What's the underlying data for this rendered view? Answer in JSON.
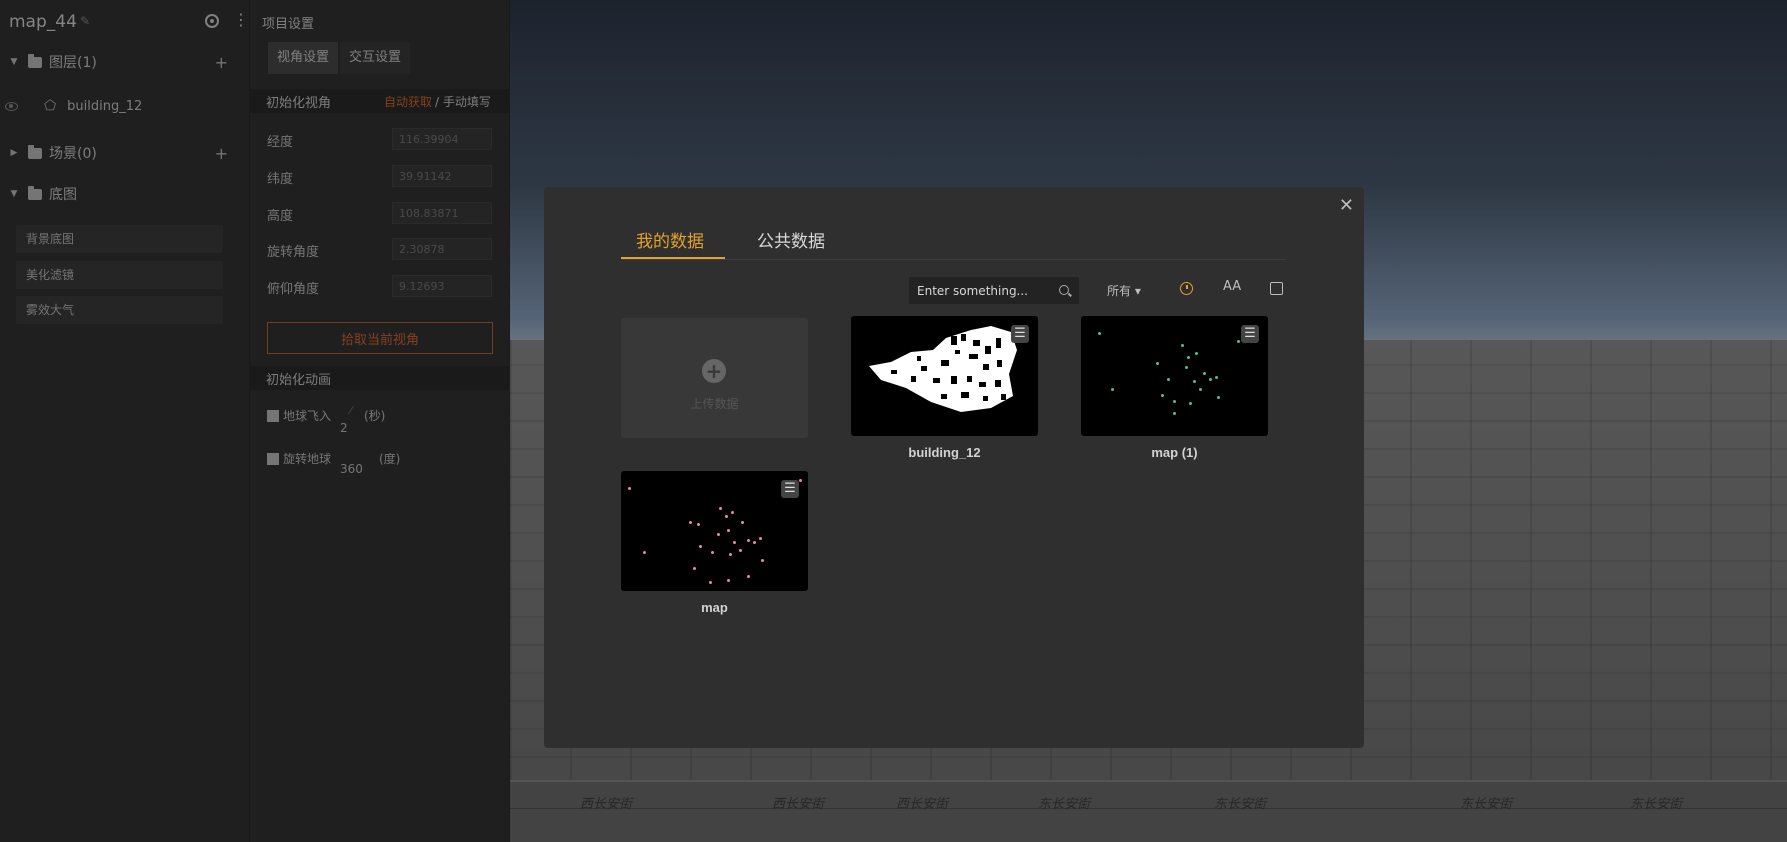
{
  "project": {
    "title": "map_44",
    "edit_glyph": "✎",
    "more_glyph": "⋮"
  },
  "sidebar": {
    "groups": [
      {
        "label": "图层(1)",
        "expanded": true,
        "add": "+"
      },
      {
        "label": "场景(0)",
        "expanded": false,
        "add": "+"
      },
      {
        "label": "底图",
        "expanded": true
      }
    ],
    "layer": {
      "label": "building_12"
    },
    "base_items": [
      "背景底图",
      "美化滤镜",
      "雾效大气"
    ]
  },
  "settings": {
    "title": "项目设置",
    "tabs": [
      "视角设置",
      "交互设置"
    ],
    "view_section": "初始化视角",
    "auto_link": "自动获取",
    "manual_link": "/ 手动填写",
    "fields": [
      {
        "label": "经度",
        "value": "116.39904"
      },
      {
        "label": "纬度",
        "value": "39.91142"
      },
      {
        "label": "高度",
        "value": "108.83871"
      },
      {
        "label": "旋转角度",
        "value": "2.30878"
      },
      {
        "label": "俯仰角度",
        "value": "9.12693"
      }
    ],
    "pick_button": "拾取当前视角",
    "anim_section": "初始化动画",
    "anims": [
      {
        "label": "地球飞入",
        "value": "2",
        "unit": "(秒)"
      },
      {
        "label": "旋转地球",
        "value": "360",
        "unit": "(度)"
      }
    ]
  },
  "map": {
    "road_labels": [
      "西长安街",
      "西长安街",
      "西长安街",
      "东长安街",
      "东长安街",
      "东长安街",
      "东长安街"
    ]
  },
  "modal": {
    "close": "✕",
    "tabs": [
      "我的数据",
      "公共数据"
    ],
    "search_placeholder": "Enter something...",
    "filter": "所有 ▾",
    "sort_az": "AA",
    "upload_label": "上传数据",
    "cards": [
      {
        "name": "building_12"
      },
      {
        "name": "map (1)"
      },
      {
        "name": "map"
      }
    ],
    "menu_glyph": "☰",
    "accent": "#e2a02e"
  }
}
